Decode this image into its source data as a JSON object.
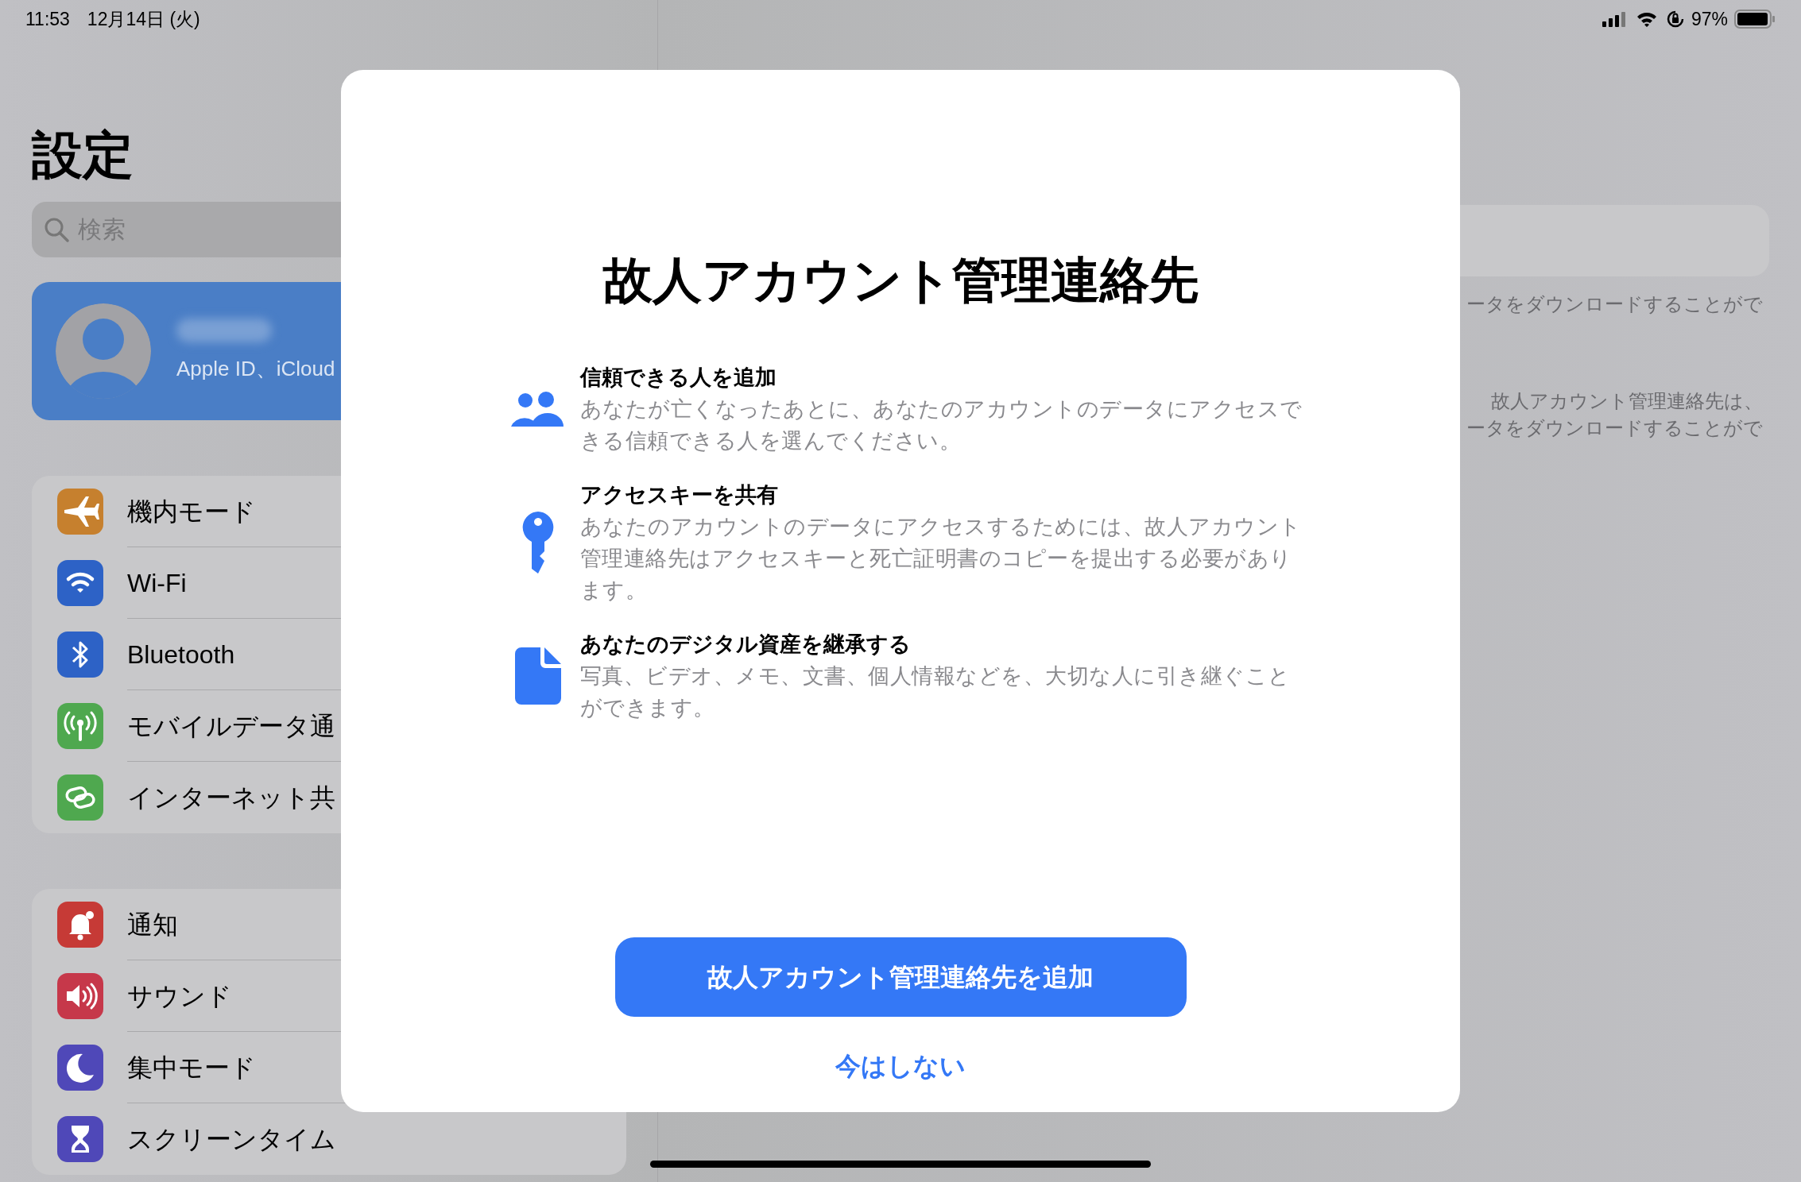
{
  "status_bar": {
    "time": "11:53",
    "date": "12月14日 (火)",
    "battery_percent": "97%"
  },
  "sidebar": {
    "title": "設定",
    "search": {
      "placeholder": "検索"
    },
    "profile": {
      "subtitle": "Apple ID、iCloud"
    },
    "groups": [
      [
        {
          "label": "機内モード",
          "color": "#c6802e"
        },
        {
          "label": "Wi-Fi",
          "color": "#2d62c6"
        },
        {
          "label": "Bluetooth",
          "color": "#2d62c6"
        },
        {
          "label": "モバイルデータ通",
          "color": "#4fa84f"
        },
        {
          "label": "インターネット共",
          "color": "#4fa84f"
        }
      ],
      [
        {
          "label": "通知",
          "color": "#c63a36"
        },
        {
          "label": "サウンド",
          "color": "#c6384a"
        },
        {
          "label": "集中モード",
          "color": "#4f48b8"
        },
        {
          "label": "スクリーンタイム",
          "color": "#4f48b8"
        }
      ]
    ]
  },
  "detail": {
    "notes": [
      {
        "lines": [
          "ータをダウンロードすることがで"
        ]
      },
      {
        "lines": [
          "故人アカウント管理連絡先は、",
          "ータをダウンロードすることがで"
        ]
      }
    ]
  },
  "modal": {
    "title": "故人アカウント管理連絡先",
    "features": [
      {
        "heading": "信頼できる人を追加",
        "body": "あなたが亡くなったあとに、あなたのアカウントのデータにアクセスできる信頼できる人を選んでください。"
      },
      {
        "heading": "アクセスキーを共有",
        "body": "あなたのアカウントのデータにアクセスするためには、故人アカウント管理連絡先はアクセスキーと死亡証明書のコピーを提出する必要があります。"
      },
      {
        "heading": "あなたのデジタル資産を継承する",
        "body": "写真、ビデオ、メモ、文書、個人情報などを、大切な人に引き継ぐことができます。"
      }
    ],
    "primary_button": "故人アカウント管理連絡先を追加",
    "secondary_button": "今はしない"
  }
}
